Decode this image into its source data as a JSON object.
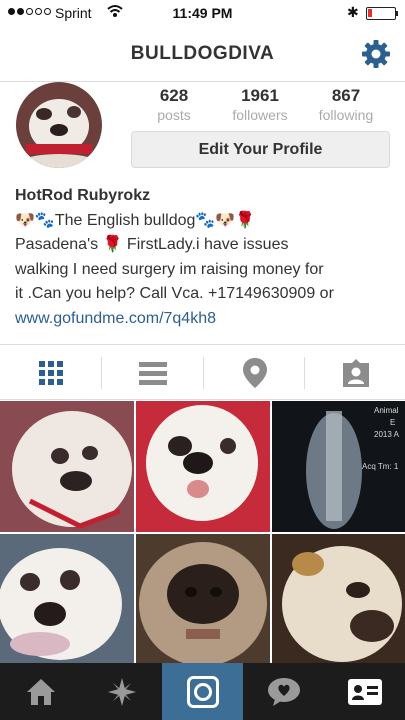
{
  "status_bar": {
    "carrier": "Sprint",
    "time": "11:49 PM",
    "bluetooth_glyph": "✱",
    "battery_color": "#e53030"
  },
  "nav": {
    "title": "BULLDOGDIVA",
    "settings_icon": "gear-icon",
    "accent": "#2a5f8f"
  },
  "profile": {
    "stats": [
      {
        "count": "628",
        "label": "posts"
      },
      {
        "count": "1961",
        "label": "followers"
      },
      {
        "count": "867",
        "label": "following"
      }
    ],
    "edit_button": "Edit Your Profile"
  },
  "bio": {
    "name": "HotRod Rubyrokz",
    "lines": [
      "🐶🐾The English bulldog🐾🐶🌹",
      "Pasadena's 🌹 FirstLady.i have issues",
      "walking I need surgery im raising money for",
      "it .Can you help? Call Vca. +17149630909 or"
    ],
    "link": "www.gofundme.com/7q4kh8"
  },
  "tabs": [
    "grid-icon",
    "list-icon",
    "location-pin-icon",
    "tagged-photos-icon"
  ],
  "grid_overlay": {
    "line1": "Animal",
    "line2": "E",
    "line3": "2013 A",
    "line4": "Acq Tm: 1"
  },
  "bottom_nav": [
    "home-icon",
    "explore-icon",
    "camera-icon",
    "activity-icon",
    "profile-icon"
  ]
}
